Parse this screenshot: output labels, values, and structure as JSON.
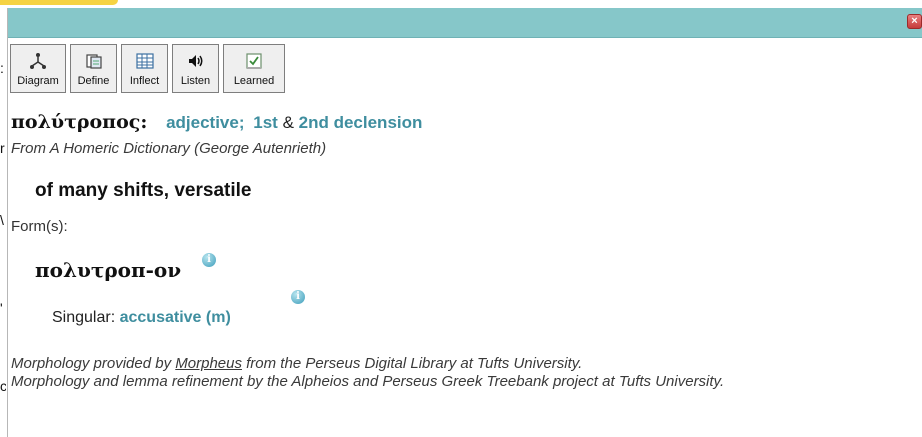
{
  "toolbar": {
    "diagram": "Diagram",
    "define": "Define",
    "inflect": "Inflect",
    "listen": "Listen",
    "learned": "Learned"
  },
  "entry": {
    "lemma": "πολύτροπος:",
    "pos": "adjective;",
    "decl1": "1st",
    "amp": "&",
    "decl2": "2nd declension",
    "source": "From A Homeric Dictionary (George Autenrieth)",
    "meaning": "of many shifts, versatile"
  },
  "forms": {
    "label": "Form(s):",
    "word": "πολυτροπ-ον",
    "singular_label": "Singular:",
    "case": "accusative (m)"
  },
  "credits": {
    "line1_pre": "Morphology provided by ",
    "line1_link": "Morpheus",
    "line1_post": " from the Perseus Digital Library at Tufts University.",
    "line2": "Morphology and lemma refinement by the Alpheios and Perseus Greek Treebank project at Tufts University."
  },
  "icons": {
    "close": "×",
    "info": "i"
  }
}
